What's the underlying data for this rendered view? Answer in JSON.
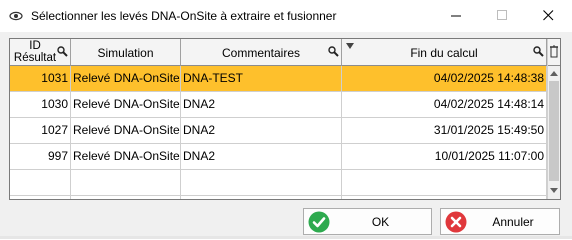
{
  "window": {
    "title": "Sélectionner les levés DNA-OnSite à extraire et fusionner",
    "icon": "eye-icon",
    "controls": [
      "minimize",
      "maximize",
      "close"
    ]
  },
  "grid": {
    "columns": [
      {
        "label": "ID Résultat",
        "filter_icon": "search-icon"
      },
      {
        "label": "Simulation"
      },
      {
        "label": "Commentaires",
        "filter_icon": "search-icon"
      },
      {
        "label": "Fin du calcul",
        "sort_icon": "sort-descending-icon",
        "filter_icon": "search-icon"
      }
    ],
    "rows": [
      {
        "id": "1031",
        "simulation": "Relevé DNA-OnSite",
        "comment": "DNA-TEST",
        "end": "04/02/2025 14:48:38",
        "selected": true
      },
      {
        "id": "1030",
        "simulation": "Relevé DNA-OnSite",
        "comment": "DNA2",
        "end": "04/02/2025 14:48:14",
        "selected": false
      },
      {
        "id": "1027",
        "simulation": "Relevé DNA-OnSite",
        "comment": "DNA2",
        "end": "31/01/2025 15:49:50",
        "selected": false
      },
      {
        "id": "997",
        "simulation": "Relevé DNA-OnSite",
        "comment": "DNA2",
        "end": "10/01/2025 11:07:00",
        "selected": false
      }
    ],
    "selection_color": "#fec02c"
  },
  "buttons": {
    "ok": {
      "label": "OK",
      "icon": "check-icon",
      "color": "#2eaa4f"
    },
    "cancel": {
      "label": "Annuler",
      "icon": "cancel-icon",
      "color": "#e0383c"
    }
  }
}
